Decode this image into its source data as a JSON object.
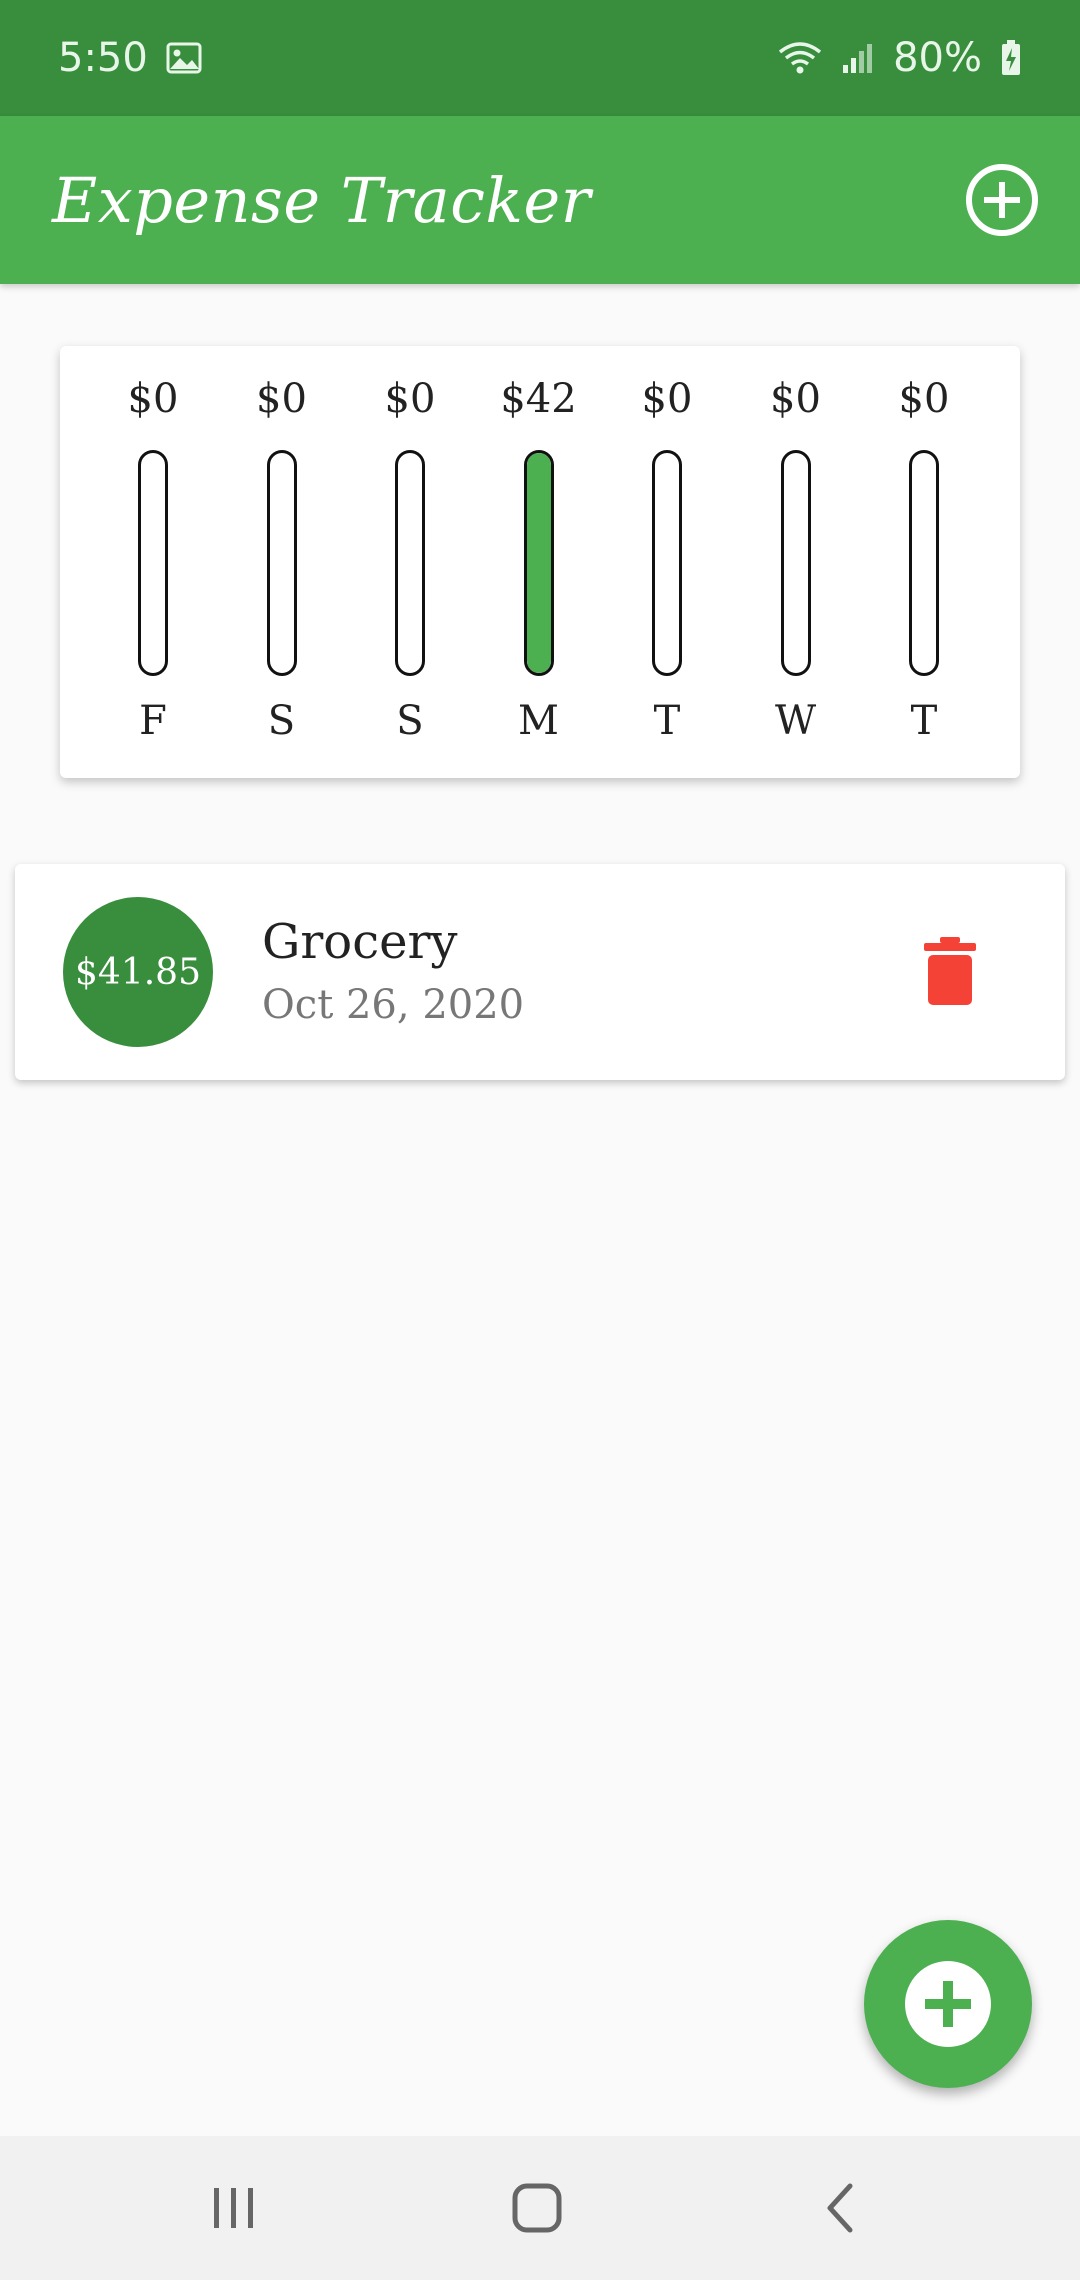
{
  "status_bar": {
    "time": "5:50",
    "battery": "80%",
    "icons": [
      "image-icon",
      "wifi-icon",
      "signal-icon",
      "battery-charging-icon"
    ]
  },
  "app_bar": {
    "title": "Expense Tracker",
    "add_icon": "add-circle-icon"
  },
  "chart_data": {
    "type": "bar",
    "categories": [
      "F",
      "S",
      "S",
      "M",
      "T",
      "W",
      "T"
    ],
    "value_labels": [
      "$0",
      "$0",
      "$0",
      "$42",
      "$0",
      "$0",
      "$0"
    ],
    "fill_fraction": [
      0,
      0,
      0,
      1,
      0,
      0,
      0
    ],
    "accent": "#4caf50"
  },
  "transactions": [
    {
      "amount": "$41.85",
      "title": "Grocery",
      "date": "Oct 26, 2020",
      "delete_icon": "trash-icon",
      "delete_color": "#f44336"
    }
  ],
  "fab": {
    "icon": "add-icon"
  },
  "nav_bar": {
    "buttons": [
      "recent-apps-icon",
      "home-icon",
      "back-icon"
    ]
  },
  "colors": {
    "primary": "#4caf50",
    "primary_dark": "#388e3c",
    "danger": "#f44336"
  }
}
